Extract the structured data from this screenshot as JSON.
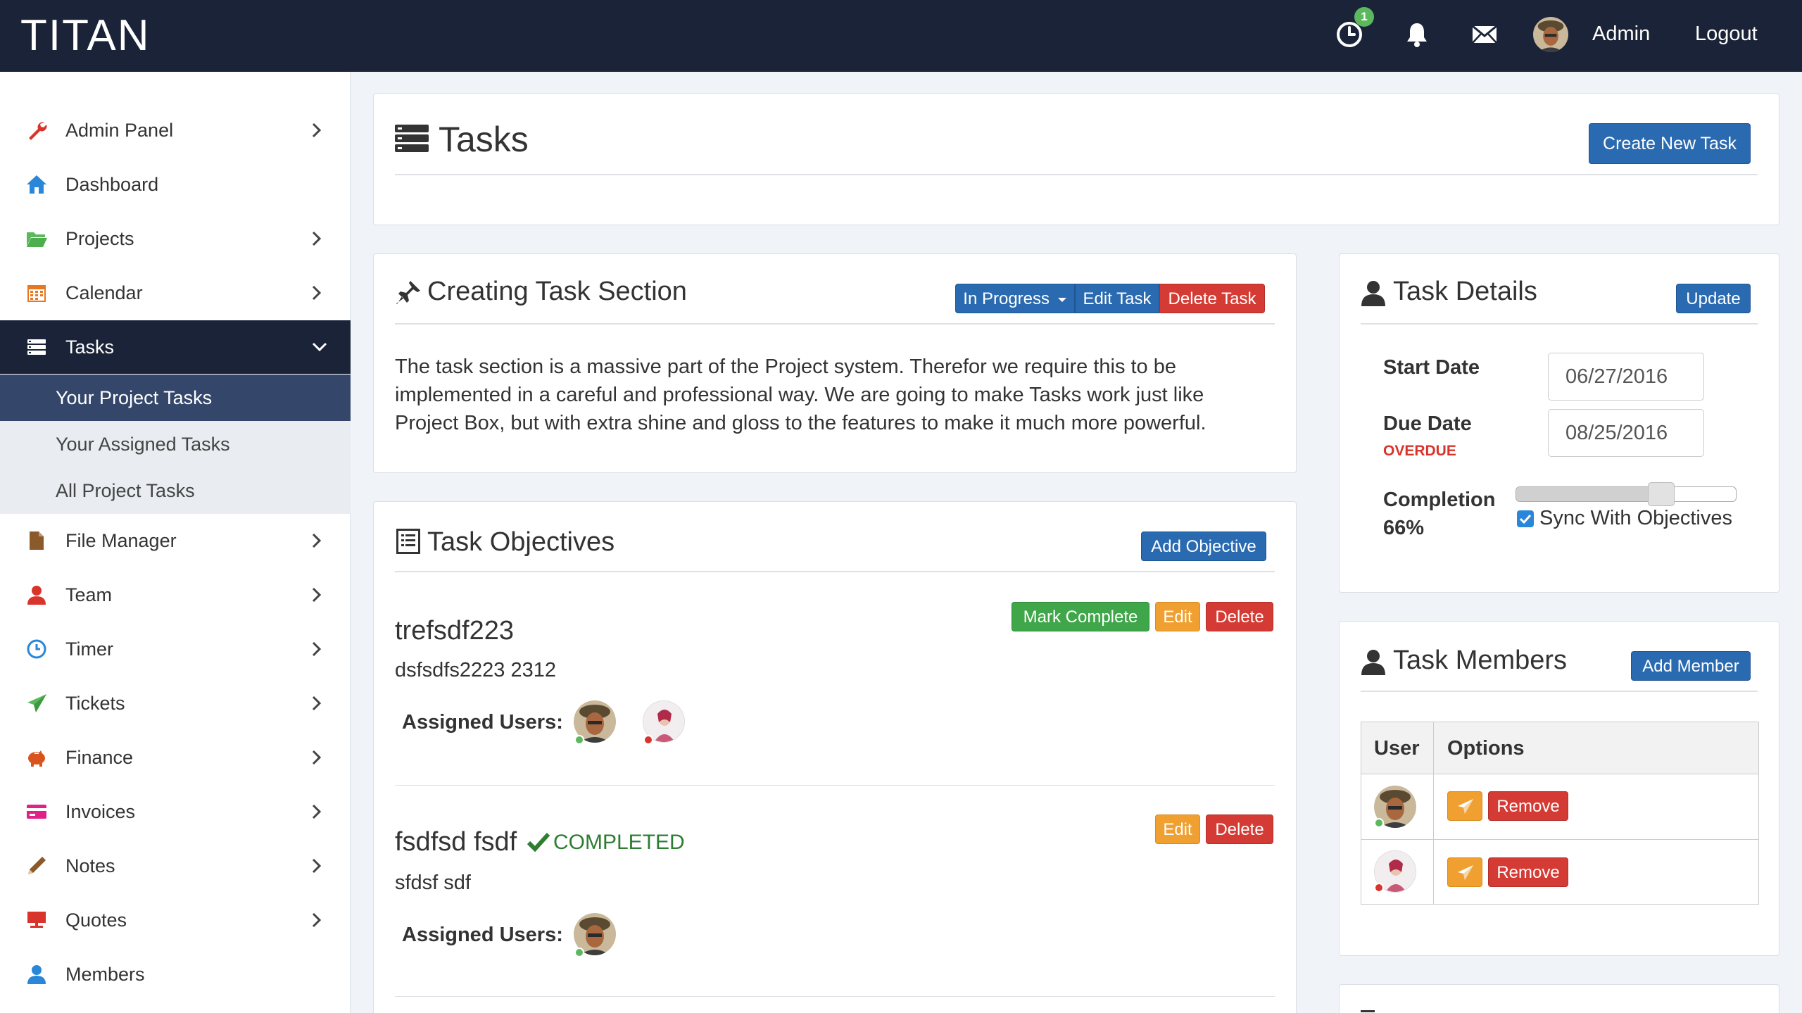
{
  "app": {
    "brand": "TITAN"
  },
  "topbar": {
    "timer_badge": "1",
    "user_label": "Admin",
    "logout_label": "Logout"
  },
  "sidebar": {
    "items": [
      {
        "label": "Admin Panel"
      },
      {
        "label": "Dashboard"
      },
      {
        "label": "Projects"
      },
      {
        "label": "Calendar"
      },
      {
        "label": "Tasks"
      },
      {
        "label": "File Manager"
      },
      {
        "label": "Team"
      },
      {
        "label": "Timer"
      },
      {
        "label": "Tickets"
      },
      {
        "label": "Finance"
      },
      {
        "label": "Invoices"
      },
      {
        "label": "Notes"
      },
      {
        "label": "Quotes"
      },
      {
        "label": "Members"
      }
    ],
    "subitems": [
      {
        "label": "Your Project Tasks"
      },
      {
        "label": "Your Assigned Tasks"
      },
      {
        "label": "All Project Tasks"
      }
    ]
  },
  "header": {
    "title": "Tasks",
    "create_label": "Create New Task"
  },
  "task": {
    "title": "Creating Task Section",
    "status_label": "In Progress",
    "edit_label": "Edit Task",
    "delete_label": "Delete Task",
    "description_lines": [
      "The task section is a massive part of the Project system. Therefor we require this to be",
      "implemented in a careful and professional way. We are going to make Tasks work just like",
      "Project Box, but with extra shine and gloss to the features to make it much more powerful."
    ]
  },
  "objectives": {
    "title": "Task Objectives",
    "add_label": "Add Objective",
    "assigned_label": "Assigned Users:",
    "mark_complete_label": "Mark Complete",
    "edit_label": "Edit",
    "delete_label": "Delete",
    "completed_label": "COMPLETED",
    "items": [
      {
        "title": "trefsdf223",
        "description": "dsfsdfs2223 2312"
      },
      {
        "title": "fsdfsd fsdf",
        "description": "sfdsf sdf"
      }
    ]
  },
  "details": {
    "title": "Task Details",
    "update_label": "Update",
    "start_label": "Start Date",
    "start_value": "06/27/2016",
    "due_label": "Due Date",
    "due_value": "08/25/2016",
    "overdue_label": "OVERDUE",
    "completion_label": "Completion",
    "completion_value": "66%",
    "completion_fraction": 0.66,
    "sync_label": "Sync With Objectives",
    "sync_checked": true
  },
  "members": {
    "title": "Task Members",
    "add_label": "Add Member",
    "columns": [
      "User",
      "Options"
    ],
    "remove_label": "Remove"
  },
  "colors": {
    "topbar": "#1b2338",
    "primary": "#2a6ab0",
    "success": "#3fa64a",
    "warning": "#f0a030",
    "danger": "#d53b35",
    "overdue": "#d9342b",
    "completed": "#2e7d32"
  }
}
